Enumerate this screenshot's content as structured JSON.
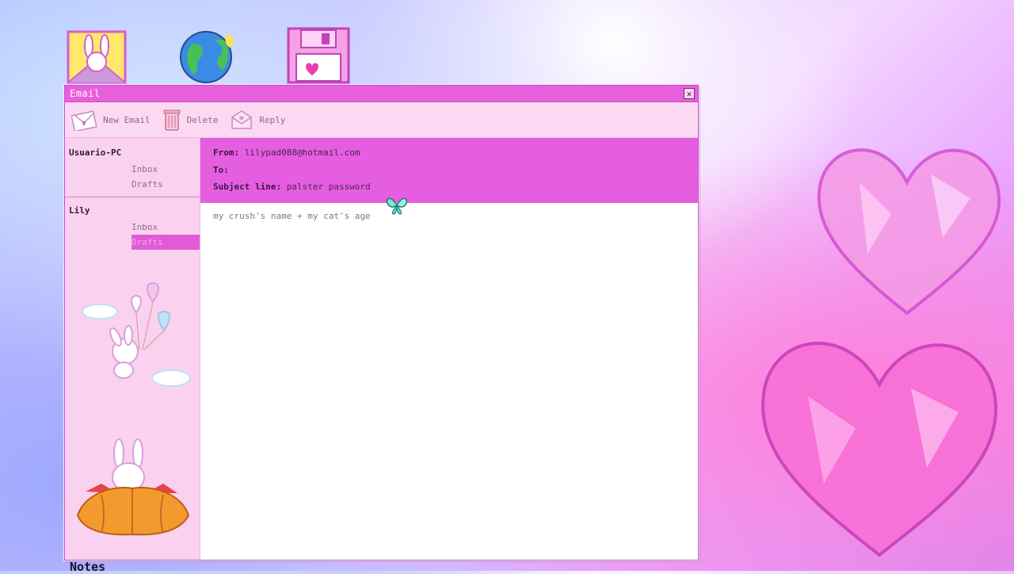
{
  "window": {
    "title": "Email",
    "close_glyph": "✕"
  },
  "toolbar": {
    "new_email": "New Email",
    "delete": "Delete",
    "reply": "Reply"
  },
  "sidebar": {
    "accounts": [
      {
        "name": "Usuario-PC",
        "folders": [
          "Inbox",
          "Drafts"
        ]
      },
      {
        "name": "Lily",
        "folders": [
          "Inbox",
          "Drafts"
        ],
        "selected": "Drafts"
      }
    ]
  },
  "message": {
    "from_label": "From:",
    "from_value": "lilypad088@hotmail.com",
    "to_label": "To:",
    "to_value": "",
    "subject_label": "Subject line:",
    "subject_value": "palster password",
    "body": "my crush's name + my cat's age"
  },
  "desktop": {
    "icons": [
      "bunny-mail-icon",
      "globe-icon",
      "floppy-disk-icon"
    ],
    "notes_label": "Notes"
  },
  "colors": {
    "titlebar": "#e85fdc",
    "window_bg": "#fbd3ef",
    "header_bg": "#e55de0",
    "selected_folder": "#e25ad8"
  }
}
